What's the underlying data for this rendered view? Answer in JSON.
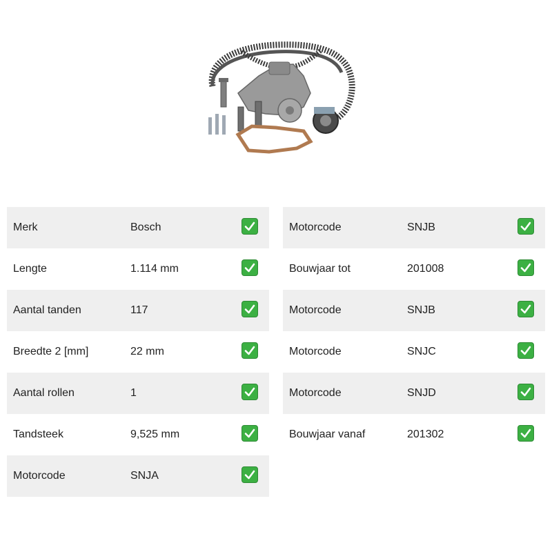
{
  "product": {
    "image_icon": "timing-belt-kit-with-water-pump"
  },
  "left_table": [
    {
      "label": "Merk",
      "value": "Bosch",
      "shaded": true
    },
    {
      "label": "Lengte",
      "value": "1.114 mm",
      "shaded": false
    },
    {
      "label": "Aantal tanden",
      "value": "117",
      "shaded": true
    },
    {
      "label": "Breedte 2 [mm]",
      "value": "22 mm",
      "shaded": false
    },
    {
      "label": "Aantal rollen",
      "value": "1",
      "shaded": true
    },
    {
      "label": "Tandsteek",
      "value": "9,525 mm",
      "shaded": false
    },
    {
      "label": "Motorcode",
      "value": "SNJA",
      "shaded": true
    }
  ],
  "right_table": [
    {
      "label": "Motorcode",
      "value": "SNJB",
      "shaded": true
    },
    {
      "label": "Bouwjaar tot",
      "value": "201008",
      "shaded": false
    },
    {
      "label": "Motorcode",
      "value": "SNJB",
      "shaded": true
    },
    {
      "label": "Motorcode",
      "value": "SNJC",
      "shaded": false
    },
    {
      "label": "Motorcode",
      "value": "SNJD",
      "shaded": true
    },
    {
      "label": "Bouwjaar vanaf",
      "value": "201302",
      "shaded": false
    }
  ],
  "colors": {
    "row_shade": "#efefef",
    "check_green": "#3cb043"
  },
  "icons": {
    "check": "check-mark-icon"
  }
}
